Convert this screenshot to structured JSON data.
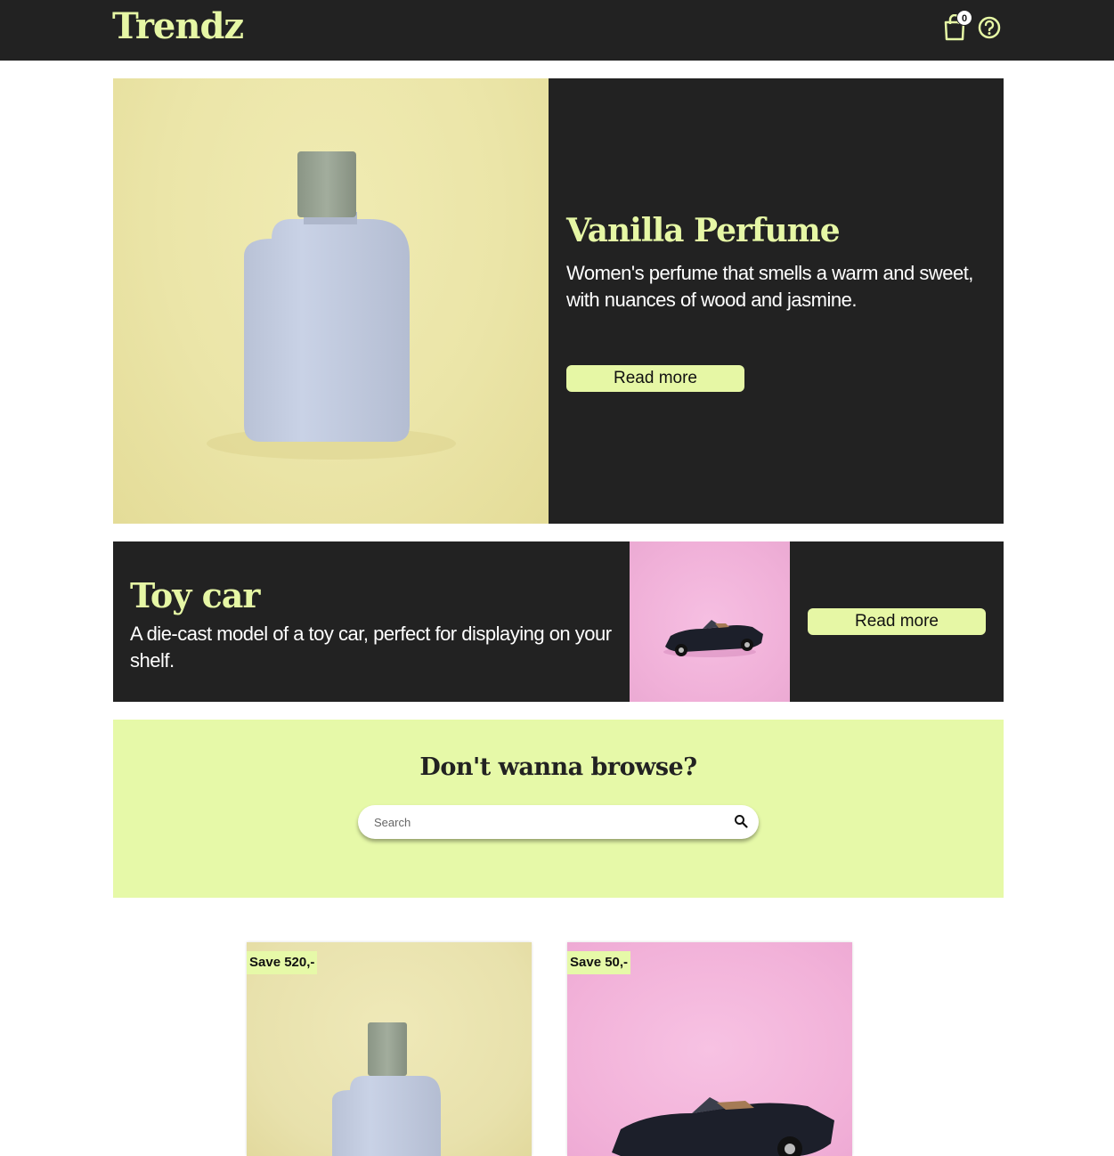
{
  "header": {
    "logo": "Trendz",
    "cart_count": "0",
    "cart_icon": "shopping-bag-icon",
    "help_icon": "question-circle-icon"
  },
  "hero": {
    "title": "Vanilla Perfume",
    "description": "Women's perfume that smells a warm and sweet, with nuances of wood and jasmine.",
    "button_label": "Read more",
    "image": "perfume-bottle-image"
  },
  "toy_banner": {
    "title": "Toy car",
    "description": "A die-cast model of a toy car, perfect for displaying on your shelf.",
    "button_label": "Read more",
    "image": "toy-car-image"
  },
  "browse": {
    "title": "Don't wanna browse?",
    "search_placeholder": "Search",
    "search_icon": "search-icon"
  },
  "products": [
    {
      "badge": "Save 520,-",
      "image": "perfume-bottle-image"
    },
    {
      "badge": "Save 50,-",
      "image": "toy-car-image"
    }
  ],
  "colors": {
    "dark": "#222222",
    "accent": "#e6f7a5",
    "perfume_bg": "#ebe5a8",
    "toy_bg": "#f0b0d8"
  }
}
